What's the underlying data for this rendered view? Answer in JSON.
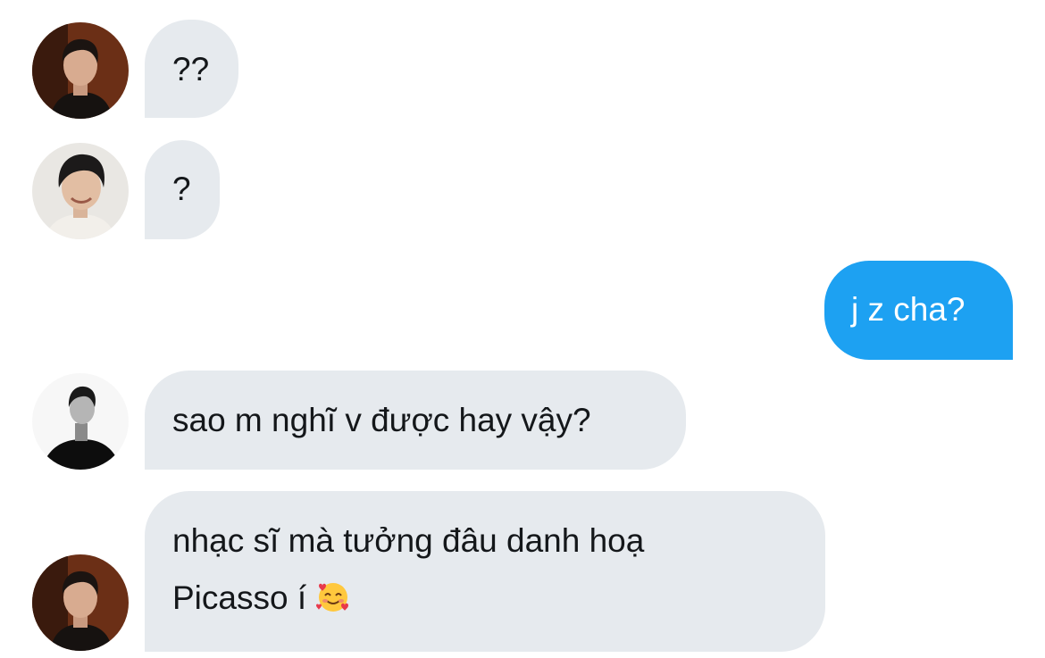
{
  "conversation": {
    "messages": [
      {
        "direction": "incoming",
        "sender_avatar": "avatar-1",
        "text": "??"
      },
      {
        "direction": "incoming",
        "sender_avatar": "avatar-2",
        "text": "?"
      },
      {
        "direction": "outgoing",
        "text": "j z cha?"
      },
      {
        "direction": "incoming",
        "sender_avatar": "avatar-3",
        "text": "sao m nghĩ v được hay vậy?"
      },
      {
        "direction": "incoming",
        "sender_avatar": "avatar-1",
        "line1": "nhạc sĩ mà tưởng đâu danh hoạ",
        "line2": "Picasso í",
        "emoji": "smiling-face-with-hearts-emoji"
      }
    ]
  },
  "colors": {
    "incoming_bubble": "#e6eaee",
    "outgoing_bubble": "#1da1f2",
    "incoming_text": "#14171a",
    "outgoing_text": "#ffffff"
  }
}
